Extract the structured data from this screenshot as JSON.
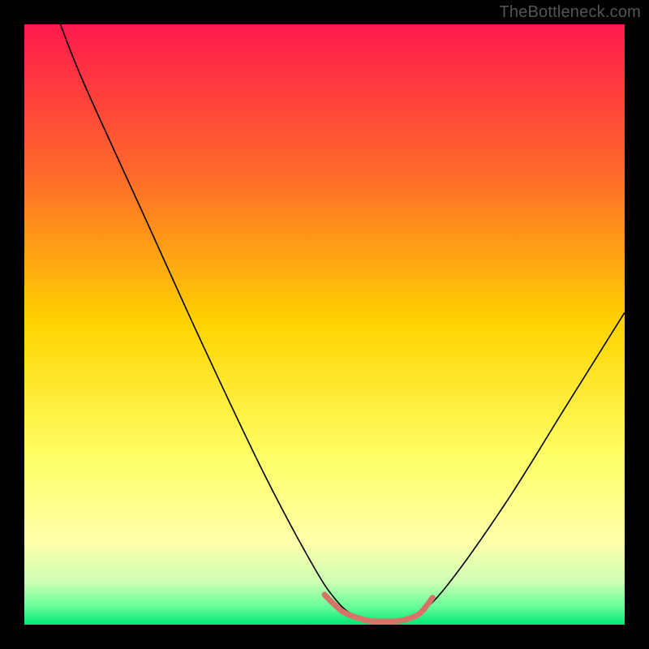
{
  "watermark": "TheBottleneck.com",
  "chart_data": {
    "type": "line",
    "title": "",
    "xlabel": "",
    "ylabel": "",
    "xlim": [
      0,
      100
    ],
    "ylim": [
      0,
      100
    ],
    "grid": false,
    "legend": false,
    "background_gradient": {
      "stops": [
        {
          "offset": 0.0,
          "color": "#ff1a4d"
        },
        {
          "offset": 0.25,
          "color": "#ff6a2a"
        },
        {
          "offset": 0.5,
          "color": "#ffd400"
        },
        {
          "offset": 0.72,
          "color": "#ffff66"
        },
        {
          "offset": 0.86,
          "color": "#ffffaa"
        },
        {
          "offset": 0.93,
          "color": "#ccffb3"
        },
        {
          "offset": 0.97,
          "color": "#66ff99"
        },
        {
          "offset": 1.0,
          "color": "#00e673"
        }
      ]
    },
    "series": [
      {
        "name": "bottleneck-curve",
        "color": "#000000",
        "width": 1.6,
        "points": [
          {
            "x": 6,
            "y": 100
          },
          {
            "x": 10,
            "y": 90
          },
          {
            "x": 20,
            "y": 68
          },
          {
            "x": 30,
            "y": 46
          },
          {
            "x": 40,
            "y": 25
          },
          {
            "x": 48,
            "y": 10
          },
          {
            "x": 52,
            "y": 4
          },
          {
            "x": 55,
            "y": 1.5
          },
          {
            "x": 58,
            "y": 0.6
          },
          {
            "x": 62,
            "y": 0.6
          },
          {
            "x": 65,
            "y": 1.5
          },
          {
            "x": 70,
            "y": 6
          },
          {
            "x": 80,
            "y": 20
          },
          {
            "x": 90,
            "y": 36
          },
          {
            "x": 100,
            "y": 52
          }
        ]
      },
      {
        "name": "optimal-zone-marker",
        "color": "#d9736a",
        "width": 7,
        "points": [
          {
            "x": 50,
            "y": 5
          },
          {
            "x": 53,
            "y": 2.2
          },
          {
            "x": 56,
            "y": 1.0
          },
          {
            "x": 58,
            "y": 0.6
          },
          {
            "x": 62,
            "y": 0.6
          },
          {
            "x": 64,
            "y": 1.0
          },
          {
            "x": 66,
            "y": 2.0
          },
          {
            "x": 68,
            "y": 4.5
          }
        ]
      }
    ]
  }
}
